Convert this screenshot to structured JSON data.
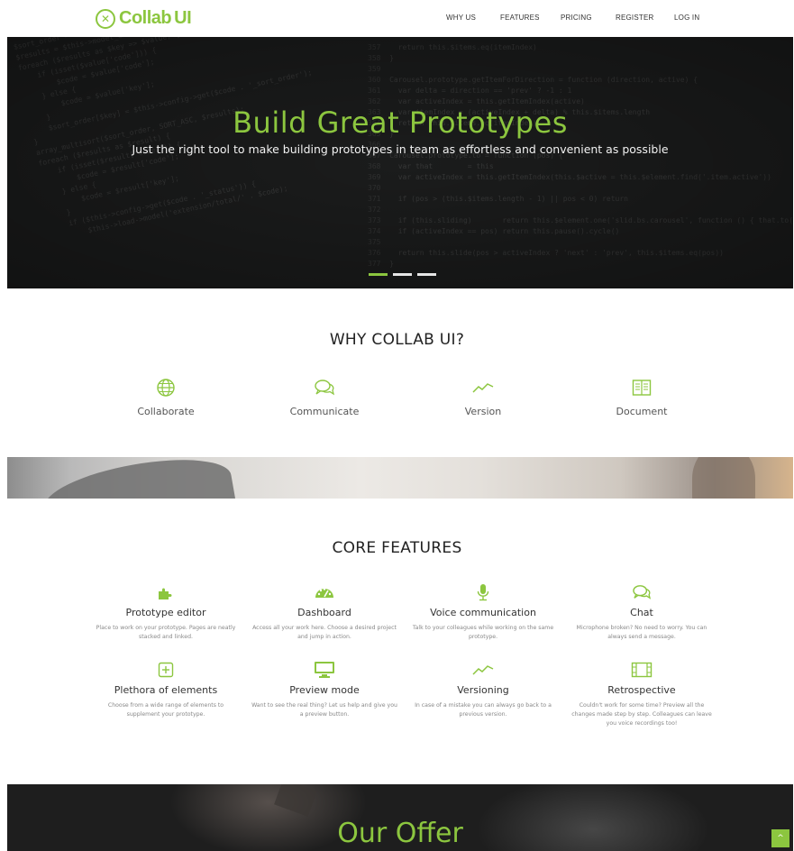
{
  "brand": {
    "name": "Collab UI",
    "name_part1": "Collab",
    "name_part2": "UI",
    "accent_color": "#8cc63f"
  },
  "nav": {
    "items": [
      {
        "label": "WHY US"
      },
      {
        "label": "FEATURES"
      },
      {
        "label": "PRICING"
      },
      {
        "label": "REGISTER"
      },
      {
        "label": "LOG IN"
      }
    ]
  },
  "hero": {
    "title": "Build Great Prototypes",
    "subtitle": "Just the right tool to make building prototypes in team as effortless and convenient as possible",
    "slides": 3,
    "active_slide": 1
  },
  "why": {
    "title": "WHY COLLAB UI?",
    "items": [
      {
        "label": "Collaborate",
        "icon": "globe-icon"
      },
      {
        "label": "Communicate",
        "icon": "chat-bubbles-icon"
      },
      {
        "label": "Version",
        "icon": "trend-line-icon"
      },
      {
        "label": "Document",
        "icon": "book-icon"
      }
    ]
  },
  "features": {
    "title": "CORE FEATURES",
    "items": [
      {
        "title": "Prototype editor",
        "desc": "Place to work on your prototype. Pages are neatly stacked and linked.",
        "icon": "puzzle-icon"
      },
      {
        "title": "Dashboard",
        "desc": "Access all your work here. Choose a desired project and jump in action.",
        "icon": "dashboard-icon"
      },
      {
        "title": "Voice communication",
        "desc": "Talk to your colleagues while working on the same prototype.",
        "icon": "microphone-icon"
      },
      {
        "title": "Chat",
        "desc": "Microphone broken? No need to worry. You can always send a message.",
        "icon": "chat-bubbles-icon"
      },
      {
        "title": "Plethora of elements",
        "desc": "Choose from a wide range of elements to supplement your prototype.",
        "icon": "plus-square-icon"
      },
      {
        "title": "Preview mode",
        "desc": "Want to see the real thing? Let us help and give you a preview button.",
        "icon": "monitor-icon"
      },
      {
        "title": "Versioning",
        "desc": "In case of a mistake you can always go back to a previous version.",
        "icon": "trend-line-icon"
      },
      {
        "title": "Retrospective",
        "desc": "Couldn't work for some time? Preview all the changes made step by step. Colleagues can leave you voice recordings too!",
        "icon": "film-icon"
      }
    ]
  },
  "offer": {
    "title": "Our Offer"
  },
  "back_to_top": {
    "label": "^"
  }
}
